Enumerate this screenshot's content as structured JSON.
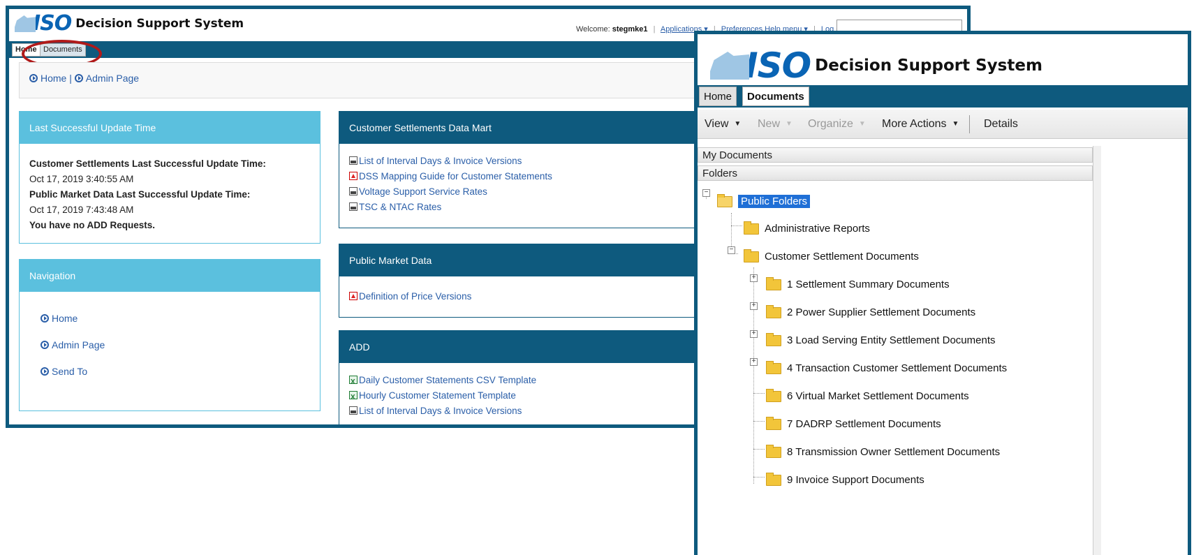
{
  "back_window": {
    "logo_iso": "ISO",
    "logo_text": "Decision Support System",
    "top_links": {
      "welcome_prefix": "Welcome:",
      "username": "stegmke1",
      "applications": "Applications ▾",
      "preferences": "Preferences",
      "help": "Help menu ▾",
      "logoff": "Log off"
    },
    "tabs": {
      "home": "Home",
      "documents": "Documents"
    },
    "breadcrumb": {
      "home": "Home",
      "sep": "|",
      "admin": "Admin Page"
    },
    "last_update": {
      "title": "Last Successful Update Time",
      "cs_label": "Customer Settlements Last Successful Update Time:",
      "cs_time": "Oct 17, 2019 3:40:55 AM",
      "pmd_label": "Public Market Data Last Successful Update Time:",
      "pmd_time": "Oct 17, 2019 7:43:48 AM",
      "add_note": "You have no ADD Requests."
    },
    "navigation": {
      "title": "Navigation",
      "items": [
        "Home",
        "Admin Page",
        "Send To"
      ]
    },
    "cs_data_mart": {
      "title": "Customer Settlements Data Mart",
      "links": [
        {
          "label": "List of Interval Days & Invoice Versions",
          "icon": "doc"
        },
        {
          "label": "DSS Mapping Guide for Customer Statements",
          "icon": "pdf"
        },
        {
          "label": "Voltage Support Service Rates",
          "icon": "doc"
        },
        {
          "label": "TSC & NTAC Rates",
          "icon": "doc"
        }
      ]
    },
    "public_market_data": {
      "title": "Public Market Data",
      "links": [
        {
          "label": "Definition of Price Versions",
          "icon": "pdf"
        }
      ]
    },
    "add": {
      "title": "ADD",
      "links": [
        {
          "label": "Daily Customer Statements CSV Template",
          "icon": "xls"
        },
        {
          "label": "Hourly Customer Statement Template",
          "icon": "xls"
        },
        {
          "label": "List of Interval Days & Invoice Versions",
          "icon": "doc"
        }
      ]
    }
  },
  "front_window": {
    "logo_iso": "ISO",
    "logo_text": "Decision Support System",
    "tabs": {
      "home": "Home",
      "documents": "Documents"
    },
    "toolbar": {
      "view": "View",
      "new": "New",
      "organize": "Organize",
      "more_actions": "More Actions",
      "details": "Details"
    },
    "sections": {
      "my_documents": "My Documents",
      "folders": "Folders"
    },
    "tree": {
      "root": "Public Folders",
      "level1": [
        "Administrative Reports",
        "Customer Settlement Documents"
      ],
      "customer_settlement_children": [
        "1 Settlement Summary Documents",
        "2 Power Supplier Settlement Documents",
        "3 Load Serving Entity Settlement Documents",
        "4 Transaction Customer Settlement Documents",
        "6 Virtual Market Settlement Documents",
        "7 DADRP Settlement Documents",
        "8 Transmission Owner Settlement Documents",
        "9 Invoice Support Documents"
      ]
    }
  },
  "colors": {
    "brand_dark": "#0e5a7e",
    "brand_light": "#5bc0de",
    "link": "#2a5ea8",
    "highlight": "#b01a1a"
  }
}
